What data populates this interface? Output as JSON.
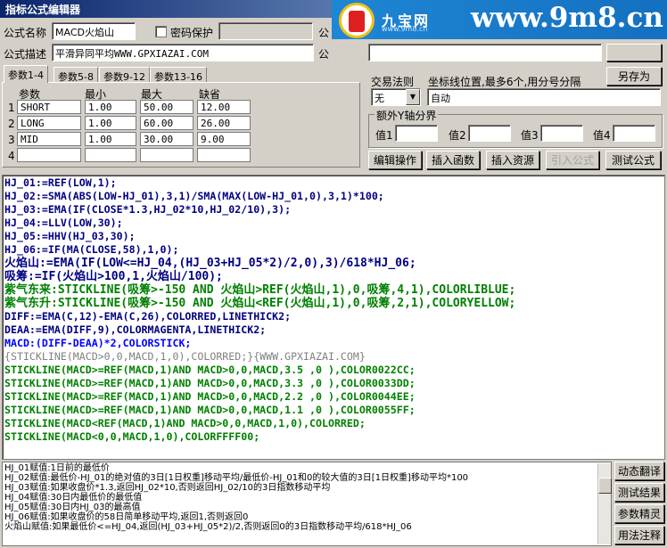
{
  "window": {
    "title": "指标公式编辑器"
  },
  "watermark": {
    "brand_cn": "九宝网",
    "brand_sub": "www.9m8.cn",
    "url": "www.9m8.cn"
  },
  "form": {
    "name_label": "公式名称",
    "name_value": "MACD火焰山",
    "password_label": "密码保护",
    "password_value": "",
    "desc_label": "公式描述",
    "desc_value": "平滑异同平均WWW.GPXIAZAI.COM",
    "right_label_1": "公",
    "right_label_2": "公"
  },
  "params": {
    "tabs": [
      "参数1-4",
      "参数5-8",
      "参数9-12",
      "参数13-16"
    ],
    "headers": [
      "参数",
      "最小",
      "最大",
      "缺省"
    ],
    "rows": [
      {
        "idx": "1",
        "name": "SHORT",
        "min": "1.00",
        "max": "50.00",
        "default": "12.00"
      },
      {
        "idx": "2",
        "name": "LONG",
        "min": "1.00",
        "max": "60.00",
        "default": "26.00"
      },
      {
        "idx": "3",
        "name": "MID",
        "min": "1.00",
        "max": "30.00",
        "default": "9.00"
      },
      {
        "idx": "4",
        "name": "",
        "min": "",
        "max": "",
        "default": ""
      }
    ]
  },
  "right": {
    "save_as": "另存为",
    "trade_rule_label": "交易法则",
    "trade_rule_value": "无",
    "coord_label": "坐标线位置,最多6个,用分号分隔",
    "coord_value": "自动",
    "y_axis_label": "额外Y轴分界",
    "value_labels": [
      "值1",
      "值2",
      "值3",
      "值4"
    ]
  },
  "toolbar": [
    "编辑操作",
    "插入函数",
    "插入资源",
    "引入公式",
    "测试公式"
  ],
  "side_buttons": [
    "动态翻译",
    "测试结果",
    "参数精灵",
    "用法注释"
  ],
  "info_lines": [
    "HJ_01赋值:1日前的最低价",
    "HJ_02赋值:最低价-HJ_01的绝对值的3日[1日权重]移动平均/最低价-HJ_01和0的较大值的3日[1日权重]移动平均*100",
    "HJ_03赋值:如果收盘价*1.3,返回HJ_02*10,否则返回HJ_02/10的3日指数移动平均",
    "HJ_04赋值:30日内最低价的最低值",
    "HJ_05赋值:30日内HJ_03的最高值",
    "HJ_06赋值:如果收盘价的58日简单移动平均,返回1,否则返回0",
    "火焰山赋值:如果最低价<=HJ_04,返回(HJ_03+HJ_05*2)/2,否则返回0的3日指数移动平均/618*HJ_06"
  ],
  "code_lines": [
    "HJ_01:=REF(LOW,1);",
    "HJ_02:=SMA(ABS(LOW-HJ_01),3,1)/SMA(MAX(LOW-HJ_01,0),3,1)*100;",
    "HJ_03:=EMA(IF(CLOSE*1.3,HJ_02*10,HJ_02/10),3);",
    "HJ_04:=LLV(LOW,30);",
    "HJ_05:=HHV(HJ_03,30);",
    "HJ_06:=IF(MA(CLOSE,58),1,0);",
    "火焰山:=EMA(IF(LOW<=HJ_04,(HJ_03+HJ_05*2)/2,0),3)/618*HJ_06;",
    "吸筹:=IF(火焰山>100,1,火焰山/100);",
    "紫气东来:STICKLINE(吸筹>-150 AND 火焰山>REF(火焰山,1),0,吸筹,4,1),COLORLIBLUE;",
    "紫气东升:STICKLINE(吸筹>-150 AND 火焰山<REF(火焰山,1),0,吸筹,2,1),COLORYELLOW;",
    "DIFF:=EMA(C,12)-EMA(C,26),COLORRED,LINETHICK2;",
    "DEAA:=EMA(DIFF,9),COLORMAGENTA,LINETHICK2;",
    "MACD:(DIFF-DEAA)*2,COLORSTICK;",
    "{STICKLINE(MACD>0,0,MACD,1,0),COLORRED;}{WWW.GPXIAZAI.COM}",
    "STICKLINE(MACD>=REF(MACD,1)AND MACD>0,0,MACD,3.5 ,0 ),COLOR0022CC;",
    "STICKLINE(MACD>=REF(MACD,1)AND MACD>0,0,MACD,3.3 ,0 ),COLOR0033DD;",
    "STICKLINE(MACD>=REF(MACD,1)AND MACD>0,0,MACD,2.2 ,0 ),COLOR0044EE;",
    "STICKLINE(MACD>=REF(MACD,1)AND MACD>0,0,MACD,1.1 ,0 ),COLOR0055FF;",
    "STICKLINE(MACD<REF(MACD,1)AND MACD>0,0,MACD,1,0),COLORRED;",
    "STICKLINE(MACD<0,0,MACD,1,0),COLORFFFF00;"
  ]
}
